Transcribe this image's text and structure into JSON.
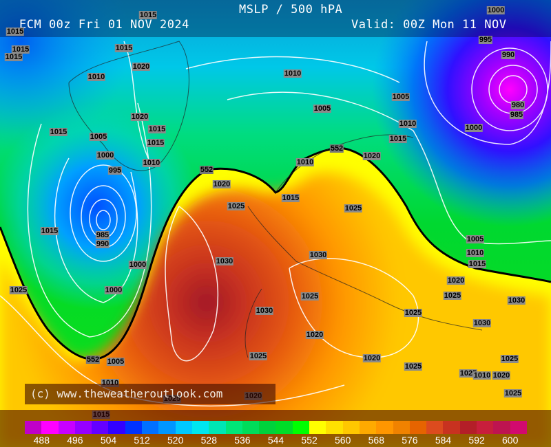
{
  "header": {
    "title": "MSLP / 500 hPA",
    "run": "ECM 00z Fri 01 NOV 2024",
    "valid": "Valid: 00Z Mon 11 NOV"
  },
  "copyright": "(c) www.theweatheroutlook.com",
  "colorbar": {
    "labels": [
      "488",
      "496",
      "504",
      "512",
      "520",
      "528",
      "536",
      "544",
      "552",
      "560",
      "568",
      "576",
      "584",
      "592",
      "600"
    ],
    "colors": [
      "#c000c8",
      "#ff00ff",
      "#c800ff",
      "#9600ff",
      "#6400ff",
      "#3200ff",
      "#0032ff",
      "#0070ff",
      "#0096ff",
      "#00c8ff",
      "#00e6f0",
      "#00e6b4",
      "#00e678",
      "#00dc5a",
      "#00d23c",
      "#00dc28",
      "#00ff00",
      "#ffff00",
      "#ffe100",
      "#ffc800",
      "#ffaa00",
      "#ff9600",
      "#f08200",
      "#e66400",
      "#dc4b1e",
      "#c83220",
      "#b41e28",
      "#c81e3c",
      "#be1450",
      "#d20a6e"
    ]
  },
  "contour_labels": [
    "1015",
    "1015",
    "1015",
    "1015",
    "1015",
    "1020",
    "1010",
    "1010",
    "1005",
    "1005",
    "1020",
    "1015",
    "1015",
    "1005",
    "1015",
    "1010",
    "1015",
    "1000",
    "995",
    "990",
    "980",
    "985",
    "1000",
    "1000",
    "995",
    "1010",
    "1010",
    "1020",
    "1020",
    "1015",
    "1025",
    "1025",
    "1015",
    "985",
    "990",
    "1000",
    "1030",
    "1030",
    "1005",
    "1010",
    "1015",
    "1020",
    "1025",
    "1030",
    "1000",
    "1025",
    "1025",
    "1030",
    "1025",
    "1030",
    "1020",
    "1025",
    "1020",
    "1025",
    "1025",
    "1025",
    "1010",
    "1005",
    "552",
    "552",
    "552",
    "1025",
    "1020",
    "1010",
    "1020",
    "1025",
    "1015"
  ],
  "thickness_contour": "552"
}
